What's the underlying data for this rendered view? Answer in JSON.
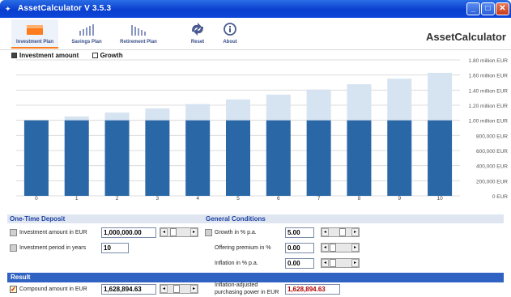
{
  "window": {
    "title": "AssetCalculator V 3.5.3",
    "min": "_",
    "max": "□",
    "close": "✕"
  },
  "toolbar": {
    "items": [
      {
        "label": "Investment Plan",
        "icon": "investment-plan-icon"
      },
      {
        "label": "Savings Plan",
        "icon": "savings-plan-icon"
      },
      {
        "label": "Retirement Plan",
        "icon": "retirement-plan-icon"
      },
      {
        "label": "Reset",
        "icon": "reset-icon"
      },
      {
        "label": "About",
        "icon": "about-icon"
      }
    ],
    "brand": "AssetCalculator"
  },
  "legend": {
    "investment": "Investment amount",
    "growth": "Growth"
  },
  "colors": {
    "investment": "#2a67a6",
    "growth": "#d6e3f1",
    "section_head": "#dfe6f2",
    "result_bar": "#2f62c2",
    "result_value": "#b00000"
  },
  "chart_data": {
    "type": "bar",
    "stacked": true,
    "categories": [
      "0",
      "1",
      "2",
      "3",
      "4",
      "5",
      "6",
      "7",
      "8",
      "9",
      "10"
    ],
    "series": [
      {
        "name": "Investment amount",
        "values": [
          1000000,
          1000000,
          1000000,
          1000000,
          1000000,
          1000000,
          1000000,
          1000000,
          1000000,
          1000000,
          1000000
        ]
      },
      {
        "name": "Growth",
        "values": [
          0,
          50000,
          102500,
          157625,
          215506,
          276282,
          340096,
          407100,
          477455,
          551328,
          628895
        ]
      }
    ],
    "yticks": [
      "0 EUR",
      "200,000 EUR",
      "400,000 EUR",
      "600,000 EUR",
      "800,000 EUR",
      "1.00 million EUR",
      "1.20 million EUR",
      "1.40 million EUR",
      "1.60 million EUR",
      "1.80 million EUR"
    ],
    "ylim": [
      0,
      1800000
    ],
    "grid": true,
    "legend_position": "top-left"
  },
  "one_time": {
    "title": "One-Time Deposit",
    "amount_label": "Investment amount in EUR",
    "amount_value": "1,000,000.00",
    "period_label": "Investment period in years",
    "period_value": "10"
  },
  "conditions": {
    "title": "General Conditions",
    "growth_label": "Growth in % p.a.",
    "growth_value": "5.00",
    "premium_label": "Offering premium in %",
    "premium_value": "0.00",
    "inflation_label": "Inflation in % p.a.",
    "inflation_value": "0.00"
  },
  "result": {
    "title": "Result",
    "compound_label": "Compound amount in EUR",
    "compound_value": "1,628,894.63",
    "inflation_label_1": "Inflation-adjusted",
    "inflation_label_2": "purchasing power in EUR",
    "inflation_value": "1,628,894.63"
  }
}
